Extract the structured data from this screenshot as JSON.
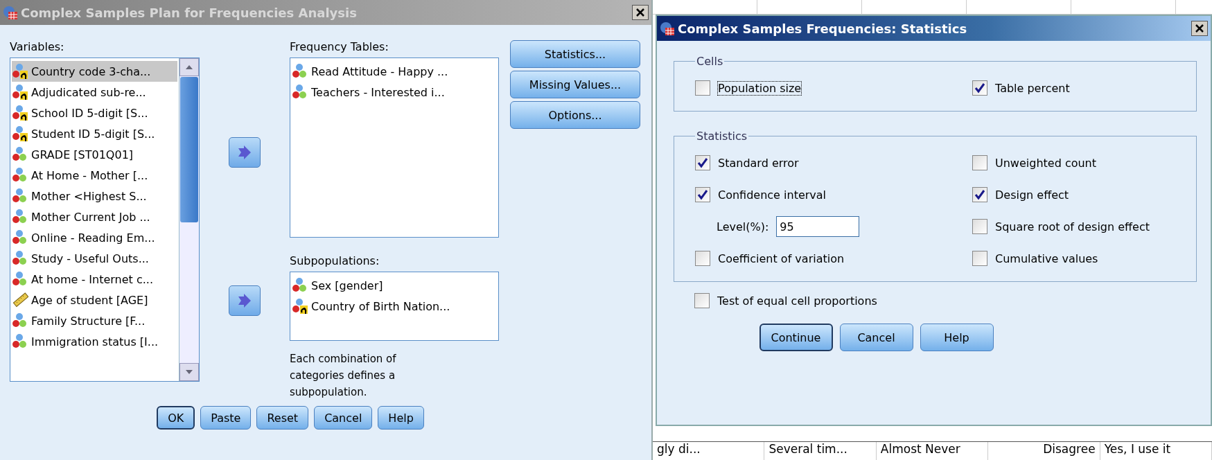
{
  "main_dialog": {
    "title": "Complex Samples Plan for Frequencies Analysis",
    "active": false,
    "variables_label": "Variables:",
    "variables": [
      {
        "label": "Country code 3-cha...",
        "kind": "string",
        "selected": true
      },
      {
        "label": "Adjudicated sub-re...",
        "kind": "string",
        "selected": false
      },
      {
        "label": "School ID 5-digit [S...",
        "kind": "string",
        "selected": false
      },
      {
        "label": "Student ID 5-digit [S...",
        "kind": "string",
        "selected": false
      },
      {
        "label": "GRADE [ST01Q01]",
        "kind": "nominal",
        "selected": false
      },
      {
        "label": "At Home - Mother [...",
        "kind": "nominal",
        "selected": false
      },
      {
        "label": "Mother  <Highest S...",
        "kind": "nominal",
        "selected": false
      },
      {
        "label": "Mother Current Job ...",
        "kind": "nominal",
        "selected": false
      },
      {
        "label": "Online - Reading Em...",
        "kind": "nominal",
        "selected": false
      },
      {
        "label": "Study - Useful Outs...",
        "kind": "nominal",
        "selected": false
      },
      {
        "label": "At home - Internet c...",
        "kind": "nominal",
        "selected": false
      },
      {
        "label": "Age of student [AGE]",
        "kind": "scale",
        "selected": false
      },
      {
        "label": "Family Structure [F...",
        "kind": "nominal",
        "selected": false
      },
      {
        "label": "Immigration status [I...",
        "kind": "nominal",
        "selected": false
      }
    ],
    "frequency_label": "Frequency Tables:",
    "frequency_tables": [
      {
        "label": "Read Attitude - Happy ...",
        "kind": "nominal"
      },
      {
        "label": "Teachers - Interested i...",
        "kind": "nominal"
      }
    ],
    "subpopulations_label": "Subpopulations:",
    "subpopulations": [
      {
        "label": "Sex [gender]",
        "kind": "nominal"
      },
      {
        "label": "Country of Birth Nation...",
        "kind": "string"
      }
    ],
    "note": "Each combination of categories defines a subpopulation.",
    "side_buttons": [
      "Statistics...",
      "Missing Values...",
      "Options..."
    ],
    "buttons": [
      {
        "label": "OK",
        "default": true
      },
      {
        "label": "Paste",
        "default": false
      },
      {
        "label": "Reset",
        "default": false
      },
      {
        "label": "Cancel",
        "default": false
      },
      {
        "label": "Help",
        "default": false
      }
    ]
  },
  "statistics_dialog": {
    "title": "Complex Samples Frequencies: Statistics",
    "active": true,
    "cells_group": "Cells",
    "cells": [
      {
        "label": "Population size",
        "checked": false,
        "focused": true
      },
      {
        "label": "Table percent",
        "checked": true,
        "focused": false
      }
    ],
    "statistics_group": "Statistics",
    "statistics_left": [
      {
        "label": "Standard error",
        "checked": true,
        "kind": "checkbox"
      },
      {
        "label": "Confidence interval",
        "checked": true,
        "kind": "checkbox"
      },
      {
        "label": "Level(%):",
        "value": "95",
        "kind": "field"
      },
      {
        "label": "Coefficient of variation",
        "checked": false,
        "kind": "checkbox"
      }
    ],
    "statistics_right": [
      {
        "label": "Unweighted count",
        "checked": false
      },
      {
        "label": "Design effect",
        "checked": true
      },
      {
        "label": "Square root of design effect",
        "checked": false
      },
      {
        "label": "Cumulative values",
        "checked": false
      }
    ],
    "test": {
      "label": "Test of equal cell proportions",
      "checked": false
    },
    "buttons": [
      {
        "label": "Continue",
        "default": true
      },
      {
        "label": "Cancel",
        "default": false
      },
      {
        "label": "Help",
        "default": false
      }
    ]
  },
  "data_grid": {
    "rows": [
      [
        "gly di...",
        "Several tim...",
        "Almost Never",
        "Disagree",
        "Yes, I use it"
      ]
    ]
  }
}
